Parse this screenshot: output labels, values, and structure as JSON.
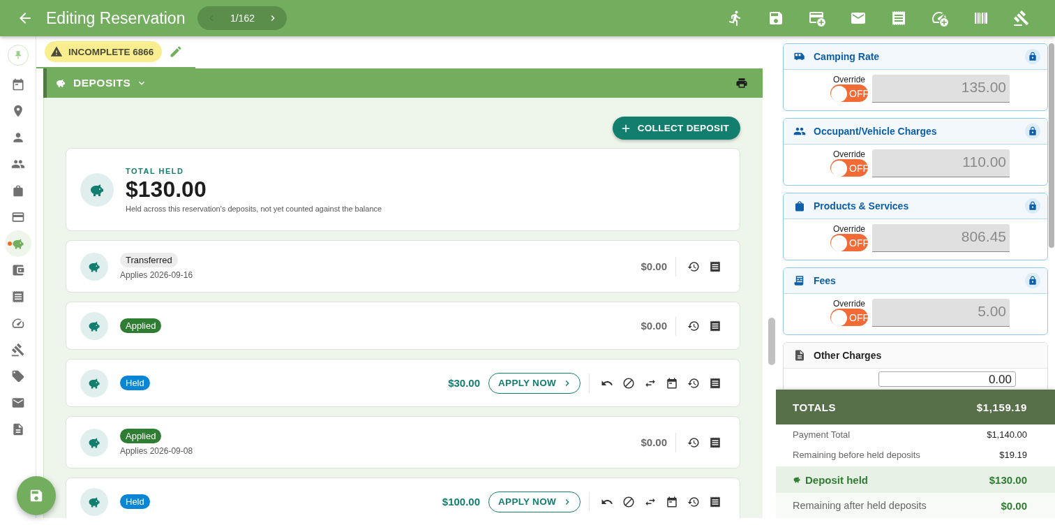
{
  "header": {
    "title": "Editing Reservation",
    "pager": "1/162"
  },
  "status_chip": {
    "label": "INCOMPLETE 6866"
  },
  "sidebar": {
    "items": [
      {
        "selected": false
      },
      {
        "selected": false
      },
      {
        "selected": false
      },
      {
        "selected": false
      },
      {
        "selected": false
      },
      {
        "selected": false
      },
      {
        "selected": true
      },
      {
        "selected": false
      },
      {
        "selected": false
      },
      {
        "selected": false
      },
      {
        "selected": false
      },
      {
        "selected": false
      },
      {
        "selected": false
      },
      {
        "selected": false
      }
    ]
  },
  "deposits": {
    "title": "DEPOSITS",
    "collect_button": "COLLECT DEPOSIT",
    "summary": {
      "label": "TOTAL HELD",
      "amount": "$130.00",
      "note": "Held across this reservation's deposits, not yet counted against the balance"
    },
    "items": [
      {
        "kind": "transferred",
        "status": "Transferred",
        "applies": "Applies 2026-09-16",
        "amount": "$0.00"
      },
      {
        "kind": "applied",
        "status": "Applied",
        "amount": "$0.00"
      },
      {
        "kind": "held",
        "status": "Held",
        "amount": "$30.00",
        "action": "APPLY NOW"
      },
      {
        "kind": "applied",
        "status": "Applied",
        "applies": "Applies 2026-09-08",
        "amount": "$0.00"
      },
      {
        "kind": "held",
        "status": "Held",
        "amount": "$100.00",
        "action": "APPLY NOW"
      }
    ]
  },
  "charges": [
    {
      "kind": "override",
      "title": "Camping Rate",
      "locked": true,
      "override_label": "Override",
      "on": false,
      "toggle_text": "OFF",
      "value": "135.00"
    },
    {
      "kind": "override",
      "title": "Occupant/Vehicle Charges",
      "locked": true,
      "override_label": "Override",
      "on": false,
      "toggle_text": "OFF",
      "value": "110.00"
    },
    {
      "kind": "override",
      "title": "Products & Services",
      "locked": true,
      "override_label": "Override",
      "on": false,
      "toggle_text": "OFF",
      "value": "806.45"
    },
    {
      "kind": "override",
      "title": "Fees",
      "locked": true,
      "override_label": "Override",
      "on": false,
      "toggle_text": "OFF",
      "value": "5.00"
    },
    {
      "kind": "other",
      "title": "Other Charges",
      "value": "0.00"
    }
  ],
  "totals": {
    "title": "TOTALS",
    "amount": "$1,159.19",
    "rows": [
      {
        "kind": "plain",
        "label": "Payment Total",
        "value": "$1,140.00"
      },
      {
        "kind": "plain",
        "label": "Remaining before held deposits",
        "value": "$19.19"
      },
      {
        "kind": "deposit",
        "label": "Deposit held",
        "value": "$130.00"
      },
      {
        "kind": "result",
        "label": "Remaining after held deposits",
        "value": "$0.00"
      }
    ]
  }
}
